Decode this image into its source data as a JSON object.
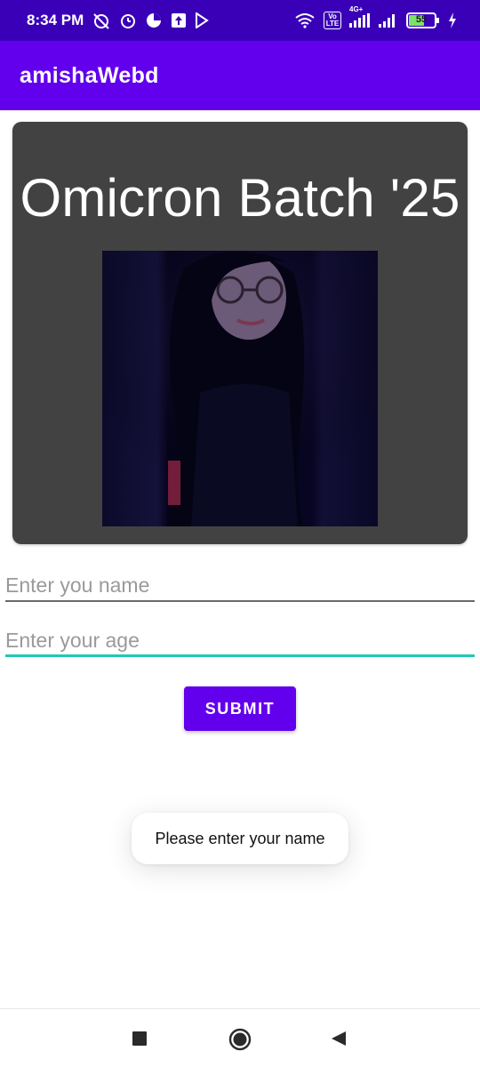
{
  "status_bar": {
    "time": "8:34 PM",
    "battery": "55",
    "network": "4G+",
    "volte": "Vo LTE",
    "background": "#3a00b8",
    "icons_left": [
      "alarm-off-icon",
      "alarm-clock-icon",
      "data-saver-icon",
      "upload-icon",
      "play-store-icon"
    ],
    "icons_right": [
      "wifi-icon",
      "volte-icon",
      "signal-icon",
      "signal-icon",
      "battery-icon",
      "charging-icon"
    ]
  },
  "app_bar": {
    "title": "amishaWebd",
    "color": "#6200ee"
  },
  "card": {
    "title": "Omicron Batch '25",
    "background": "#424242"
  },
  "form": {
    "name_placeholder": "Enter you name",
    "age_placeholder": "Enter your age",
    "focused_line_color": "#1ec8b8",
    "submit_label": "SUBMIT"
  },
  "toast": {
    "message": "Please enter your name"
  },
  "nav_bar": {
    "icons": [
      "recents-square-icon",
      "home-circle-icon",
      "back-triangle-icon"
    ]
  }
}
